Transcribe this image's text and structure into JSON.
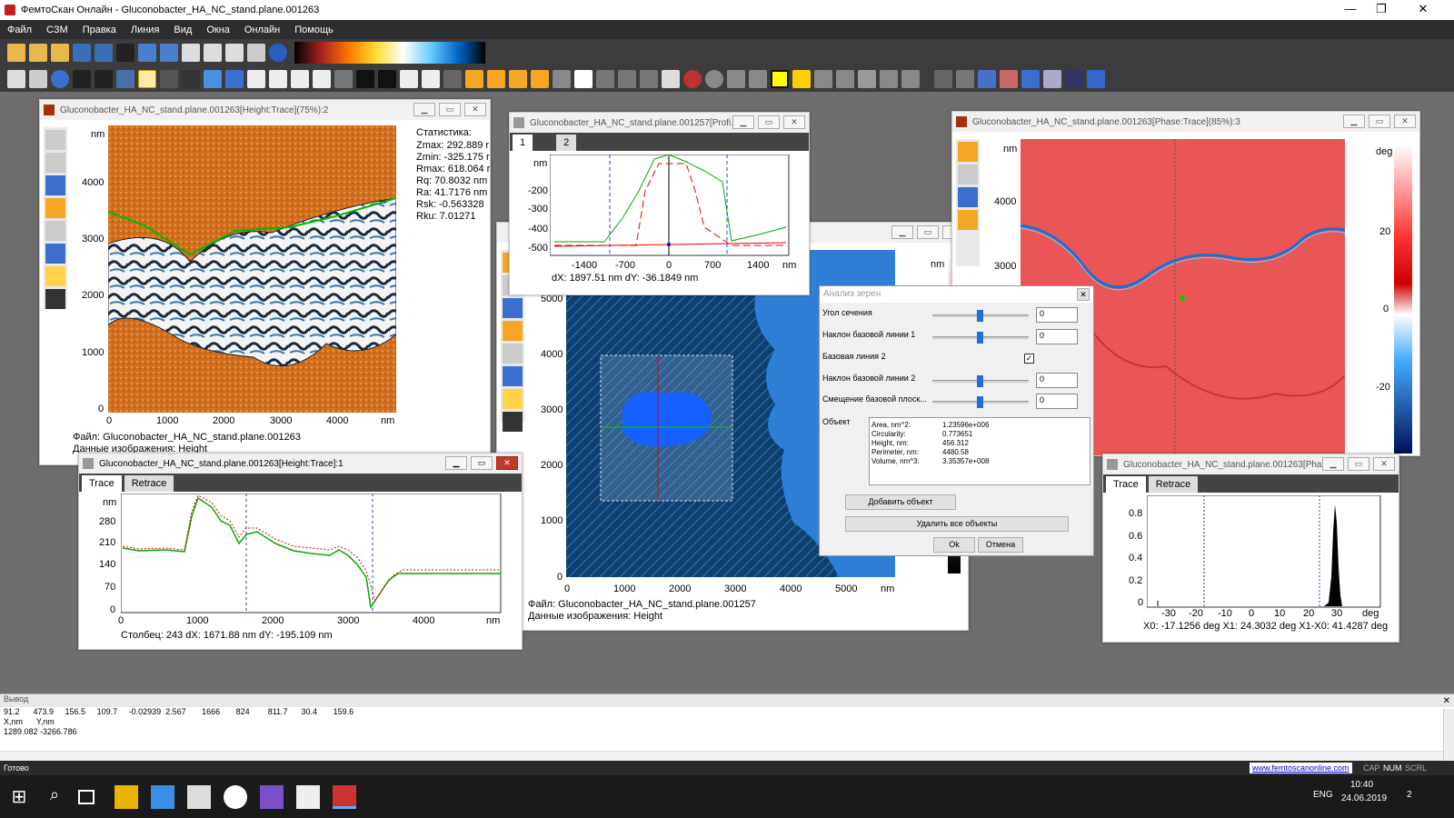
{
  "app": {
    "title": "ФемтоСкан Онлайн - Gluconobacter_HA_NC_stand.plane.001263",
    "menu": [
      "Файл",
      "СЗМ",
      "Правка",
      "Линия",
      "Вид",
      "Окна",
      "Онлайн",
      "Помощь"
    ]
  },
  "win_topo": {
    "title": "Gluconobacter_HA_NC_stand.plane.001263[Height:Trace](75%):2",
    "unit": "nm",
    "y_ticks": [
      "4000",
      "3000",
      "2000",
      "1000",
      "0"
    ],
    "x_ticks": [
      "0",
      "1000",
      "2000",
      "3000",
      "4000",
      "nm"
    ],
    "stats_title": "Статистика:",
    "stats": [
      "Zmax: 292.889 r",
      "Zmin: -325.175 r",
      "Rmax: 618.064 r",
      "Rq: 70.8032 nm",
      "Ra: 41.7176 nm",
      "Rsk: -0.563328",
      "Rku: 7.01271"
    ],
    "file_line": "Файл: Gluconobacter_HA_NC_stand.plane.001263",
    "data_line": "Данные изображения: Height"
  },
  "win_profile1": {
    "title": "Gluconobacter_HA_NC_stand.plane.001263[Height:Trace]:1",
    "tabs": [
      "Trace",
      "Retrace"
    ],
    "y_ticks": [
      "nm",
      "280",
      "210",
      "140",
      "70",
      "0"
    ],
    "x_ticks": [
      "0",
      "1000",
      "2000",
      "3000",
      "4000",
      "nm"
    ],
    "footer": "Столбец: 243    dX: 1671.88 nm  dY: -195.109 nm"
  },
  "win_profile2": {
    "title": "Gluconobacter_HA_NC_stand.plane.001257[Profi...",
    "tabs": [
      "1",
      "2"
    ],
    "y_ticks": [
      "nm",
      "-200",
      "-300",
      "-400",
      "-500"
    ],
    "x_ticks": [
      "-1400",
      "-700",
      "0",
      "700",
      "1400",
      "nm"
    ],
    "footer": "dX: 1897.51 nm  dY: -36.1849 nm"
  },
  "win_grain": {
    "unit": "nm",
    "y_ticks": [
      "5000",
      "4000",
      "3000",
      "2000",
      "1000",
      "0"
    ],
    "x_ticks": [
      "0",
      "1000",
      "2000",
      "3000",
      "4000",
      "5000",
      "nm"
    ],
    "file_line": "Файл: Gluconobacter_HA_NC_stand.plane.001257",
    "data_line": "Данные изображения: Height"
  },
  "dialog": {
    "title": "Анализ зерен",
    "rows": [
      "Угол сечения",
      "Наклон базовой линии 1",
      "Базовая линия 2",
      "Наклон базовой линии 2",
      "Смещение базовой плоск..."
    ],
    "spin_values": [
      "0",
      "0",
      "0",
      "0"
    ],
    "object_label": "Объект",
    "object_props": [
      "Area, nm^2:",
      "Circularity:",
      "Height, nm:",
      "Perimeter, nm:",
      "Volume, nm^3:"
    ],
    "object_values": [
      "1.23596e+006",
      "0.773651",
      "456.312",
      "4480.58",
      "3.35357e+008"
    ],
    "add_btn": "Добавить объект",
    "del_btn": "Удалить все объекты",
    "ok_btn": "Ok",
    "cancel_btn": "Отмена"
  },
  "win_phase": {
    "title": "Gluconobacter_HA_NC_stand.plane.001263[Phase:Trace](85%):3",
    "unit": "nm",
    "y_ticks": [
      "4000",
      "3000"
    ],
    "color_unit": "deg",
    "color_ticks": [
      "20",
      "0",
      "-20"
    ]
  },
  "win_hist": {
    "title": "Gluconobacter_HA_NC_stand.plane.001263[Pha...",
    "tabs": [
      "Trace",
      "Retrace"
    ],
    "y_ticks": [
      "0.8",
      "0.6",
      "0.4",
      "0.2",
      "0"
    ],
    "x_ticks": [
      "-30",
      "-20",
      "-10",
      "0",
      "10",
      "20",
      "30",
      "deg"
    ],
    "footer": "X0: -17.1256 deg   X1: 24.3032 deg   X1-X0: 41.4287 deg"
  },
  "output": {
    "title": "Вывод",
    "lines": [
      "91.2      473.9     156.5     109.7     -0.02939  2.567       1666       824        811.7      30.4       159.6",
      "X,nm      Y,nm",
      "1289.082 -3266.786"
    ]
  },
  "status": {
    "ready": "Готово",
    "url": "www.femtoscanonline.com",
    "indicators": [
      "CAP",
      "NUM",
      "SCRL"
    ]
  },
  "taskbar": {
    "lang": "ENG",
    "time": "10:40",
    "date": "24.06.2019",
    "notif": "2"
  }
}
